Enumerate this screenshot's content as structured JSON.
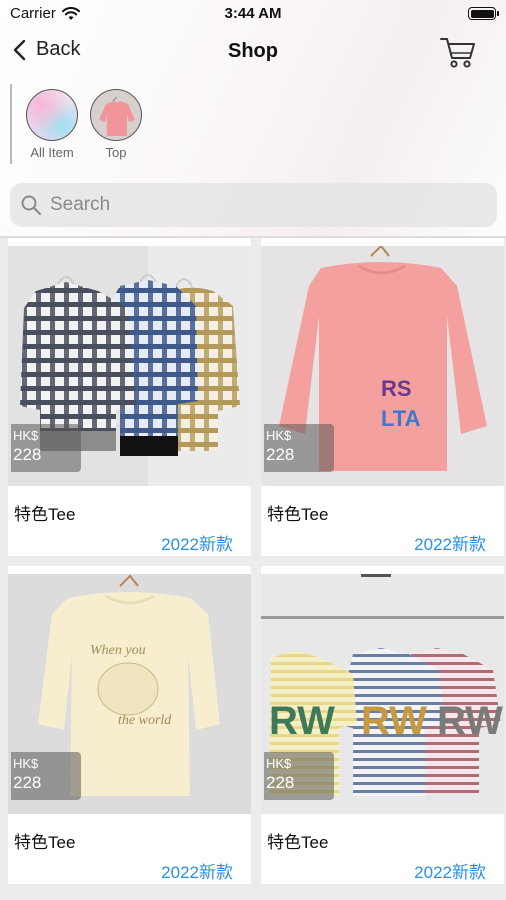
{
  "status_bar": {
    "carrier": "Carrier",
    "time": "3:44 AM"
  },
  "nav": {
    "back_label": "Back",
    "title": "Shop"
  },
  "categories": [
    {
      "label": "All Item"
    },
    {
      "label": "Top"
    }
  ],
  "search": {
    "placeholder": "Search"
  },
  "products": [
    {
      "currency": "HK$",
      "price": "228",
      "name": "特色Tee",
      "tag": "2022新款"
    },
    {
      "currency": "HK$",
      "price": "228",
      "name": "特色Tee",
      "tag": "2022新款"
    },
    {
      "currency": "HK$",
      "price": "228",
      "name": "特色Tee",
      "tag": "2022新款"
    },
    {
      "currency": "HK$",
      "price": "228",
      "name": "特色Tee",
      "tag": "2022新款"
    }
  ],
  "colors": {
    "accent": "#2d8ee6",
    "price_overlay": "#5a5a5a"
  }
}
